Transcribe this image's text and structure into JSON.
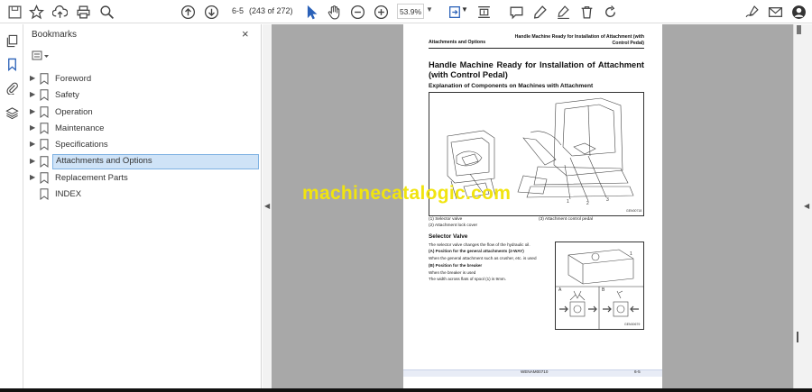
{
  "toolbar": {
    "page_label": "6-5",
    "page_count": "(243 of 272)",
    "zoom": "53.9%"
  },
  "bookmarks": {
    "title": "Bookmarks",
    "close": "×",
    "items": [
      {
        "label": "Foreword",
        "expandable": true,
        "selected": false
      },
      {
        "label": "Safety",
        "expandable": true,
        "selected": false
      },
      {
        "label": "Operation",
        "expandable": true,
        "selected": false
      },
      {
        "label": "Maintenance",
        "expandable": true,
        "selected": false
      },
      {
        "label": "Specifications",
        "expandable": true,
        "selected": false
      },
      {
        "label": "Attachments and Options",
        "expandable": true,
        "selected": true
      },
      {
        "label": "Replacement Parts",
        "expandable": true,
        "selected": false
      },
      {
        "label": "INDEX",
        "expandable": false,
        "selected": false
      }
    ]
  },
  "page": {
    "header_left": "Attachments and Options",
    "header_right": "Handle Machine Ready for Installation of Attachment (with Control Pedal)",
    "title": "Handle Machine Ready for Installation of Attachment (with Control Pedal)",
    "subtitle": "Explanation of Components on Machines with Attachment",
    "fig1_code": "GEN00718",
    "captions": {
      "c1": "(1) Selector valve",
      "c2": "(2) Attachment lock cover",
      "c3": "(3) Attachment control pedal"
    },
    "section": "Selector Valve",
    "body": [
      {
        "text": "The selector valve changes the flow of the hydraulic oil.",
        "bold": false
      },
      {
        "text": "(A) Position for the general attachments (2-WAY)",
        "bold": true
      },
      {
        "text": "When the general attachment such as crusher, etc. is used",
        "bold": false
      },
      {
        "text": "(B) Position for the breaker",
        "bold": true
      },
      {
        "text": "When the breaker is used",
        "bold": false
      },
      {
        "text": "The width across flats of spool (1) is 9mm.",
        "bold": false
      }
    ],
    "fig2_code": "GEN00679",
    "fig2_labels": {
      "a": "A",
      "b": "B",
      "one": "1"
    },
    "fig1_labels": {
      "one": "1",
      "two": "2",
      "three": "3"
    },
    "footer_center": "WENAM00710",
    "footer_right": "6-5"
  },
  "watermark": "machinecatalogic.com",
  "colors": {
    "selection_bg": "#cfe3f7",
    "doc_bg": "#a8a8a8",
    "watermark": "#f1e40f"
  }
}
